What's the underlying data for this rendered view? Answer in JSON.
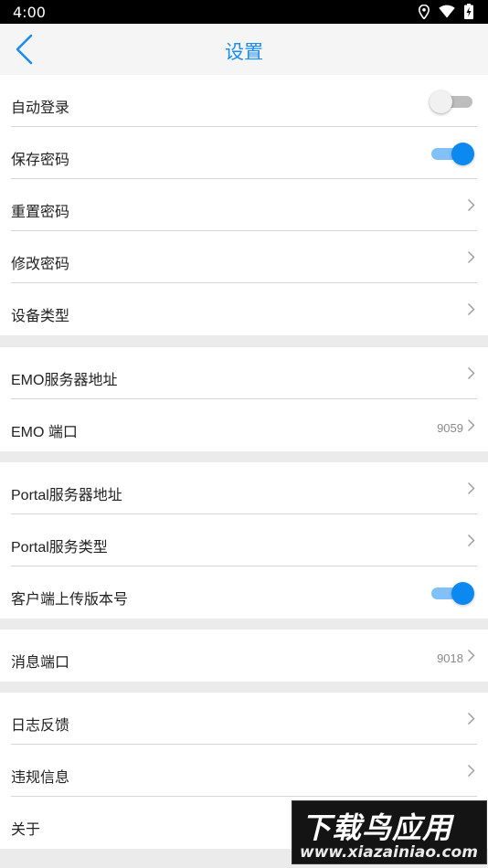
{
  "status_bar": {
    "time": "4:00"
  },
  "header": {
    "title": "设置"
  },
  "groups": [
    {
      "rows": [
        {
          "label": "自动登录",
          "control": "toggle",
          "state": "off"
        },
        {
          "label": "保存密码",
          "control": "toggle",
          "state": "on"
        },
        {
          "label": "重置密码",
          "control": "chevron"
        },
        {
          "label": "修改密码",
          "control": "chevron"
        },
        {
          "label": "设备类型",
          "control": "chevron"
        }
      ]
    },
    {
      "rows": [
        {
          "label": "EMO服务器地址",
          "control": "chevron"
        },
        {
          "label": "EMO 端口",
          "control": "chevron",
          "value": "9059"
        }
      ]
    },
    {
      "rows": [
        {
          "label": "Portal服务器地址",
          "control": "chevron"
        },
        {
          "label": "Portal服务类型",
          "control": "chevron"
        },
        {
          "label": "客户端上传版本号",
          "control": "toggle",
          "state": "on"
        }
      ]
    },
    {
      "rows": [
        {
          "label": "消息端口",
          "control": "chevron",
          "value": "9018"
        }
      ]
    },
    {
      "rows": [
        {
          "label": "日志反馈",
          "control": "chevron"
        },
        {
          "label": "违规信息",
          "control": "chevron"
        },
        {
          "label": "关于",
          "control": "chevron"
        }
      ]
    }
  ],
  "watermark": {
    "main": "下载鸟应用",
    "url": "www.xiazainiao.com"
  },
  "colors": {
    "accent": "#1a8df1",
    "toggle_on": "#0c88f1",
    "toggle_track_on": "#82c1f8",
    "toggle_off": "#bdbdbd",
    "divider": "#d6d6d6",
    "background": "#ebebeb"
  }
}
